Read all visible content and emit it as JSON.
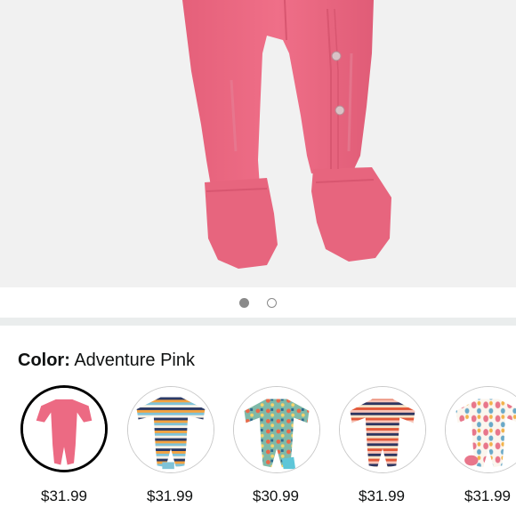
{
  "gallery": {
    "page_count": 2,
    "active_page": 1
  },
  "color_selector": {
    "label": "Color:",
    "selected_value": "Adventure Pink"
  },
  "swatches": [
    {
      "price": "$31.99",
      "selected": true,
      "pattern": "solid-pink"
    },
    {
      "price": "$31.99",
      "selected": false,
      "pattern": "stripes-multi"
    },
    {
      "price": "$30.99",
      "selected": false,
      "pattern": "teal-print"
    },
    {
      "price": "$31.99",
      "selected": false,
      "pattern": "stripes-warm"
    },
    {
      "price": "$31.99",
      "selected": false,
      "pattern": "balloons"
    }
  ],
  "colors": {
    "product_pink": "#ec6a83",
    "selected_border": "#000000",
    "hero_background": "#f1f1f1"
  }
}
